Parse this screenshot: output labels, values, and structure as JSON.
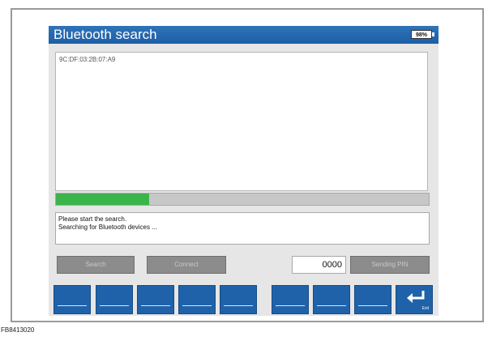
{
  "window": {
    "title": "Bluetooth search",
    "battery": "98%"
  },
  "devices": [
    "9C:DF:03:2B:07:A9"
  ],
  "progress": {
    "fraction": 0.25,
    "color": "#3bb54a"
  },
  "status": {
    "lines": [
      "Please start the search.",
      "Searching for Bluetooth devices ..."
    ]
  },
  "buttons": {
    "search": "Search",
    "connect": "Connect",
    "send_pin": "Sending PIN"
  },
  "pin": {
    "value": "0000"
  },
  "function_keys": {
    "exit_label": "Exit",
    "exit_icon": "return-arrow-icon"
  },
  "figure_id": "FB8413020",
  "colors": {
    "title_bar": "#1d5fa6",
    "function_key": "#1f62a9",
    "button": "#8c8c8c"
  }
}
